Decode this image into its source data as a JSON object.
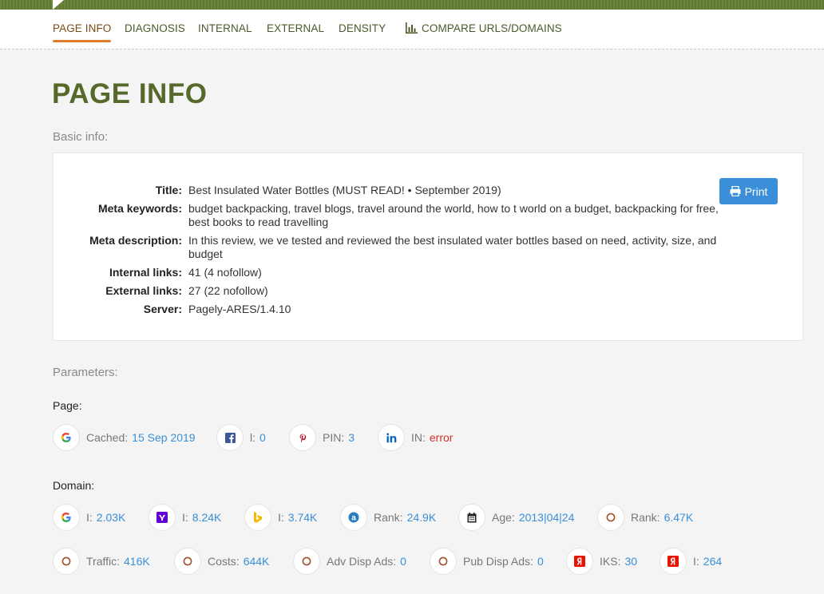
{
  "nav": {
    "items": [
      "PAGE INFO",
      "DIAGNOSIS",
      "INTERNAL",
      "EXTERNAL",
      "DENSITY"
    ],
    "compare_label": "COMPARE URLS/DOMAINS",
    "active": "PAGE INFO"
  },
  "page_title": "PAGE INFO",
  "basic_info": {
    "heading": "Basic info:",
    "rows": [
      {
        "label": "Title:",
        "value": "Best Insulated Water Bottles (MUST READ! • September 2019)"
      },
      {
        "label": "Meta keywords:",
        "value": "budget backpacking, travel blogs, travel around the world, how to t world on a budget, backpacking for free, best books to read travelling"
      },
      {
        "label": "Meta description:",
        "value": "In this review, we ve tested and reviewed the best insulated water bottles based on need, activity, size, and budget"
      },
      {
        "label": "Internal links:",
        "value": "41 (4 nofollow)"
      },
      {
        "label": "External links:",
        "value": "27 (22 nofollow)"
      },
      {
        "label": "Server:",
        "value": "Pagely-ARES/1.4.10"
      }
    ],
    "print_label": "Print"
  },
  "parameters": {
    "heading": "Parameters:",
    "page_label": "Page:",
    "page_metrics": [
      {
        "icon": "google-icon",
        "label": "Cached:",
        "value": "15 Sep 2019"
      },
      {
        "icon": "facebook-icon",
        "label": "l:",
        "value": "0"
      },
      {
        "icon": "pinterest-icon",
        "label": "PIN:",
        "value": "3"
      },
      {
        "icon": "linkedin-icon",
        "label": "IN:",
        "value": "error"
      }
    ],
    "domain_label": "Domain:",
    "domain_metrics_row1": [
      {
        "icon": "google-icon",
        "label": "I:",
        "value": "2.03K"
      },
      {
        "icon": "yahoo-icon",
        "label": "I:",
        "value": "8.24K"
      },
      {
        "icon": "bing-icon",
        "label": "I:",
        "value": "3.74K"
      },
      {
        "icon": "alexa-icon",
        "label": "Rank:",
        "value": "24.9K"
      },
      {
        "icon": "calendar-icon",
        "label": "Age:",
        "value": "2013|04|24"
      },
      {
        "icon": "semrush-icon",
        "label": "Rank:",
        "value": "6.47K"
      }
    ],
    "domain_metrics_row2": [
      {
        "icon": "semrush-icon",
        "label": "Traffic:",
        "value": "416K"
      },
      {
        "icon": "semrush-icon",
        "label": "Costs:",
        "value": "644K"
      },
      {
        "icon": "semrush-icon",
        "label": "Adv Disp Ads:",
        "value": "0"
      },
      {
        "icon": "semrush-icon",
        "label": "Pub Disp Ads:",
        "value": "0"
      },
      {
        "icon": "yandex-icon",
        "label": "IKS:",
        "value": "30"
      },
      {
        "icon": "yandex-icon",
        "label": "I:",
        "value": "264"
      }
    ]
  },
  "colors": {
    "brand_green": "#55692b",
    "accent_orange": "#e07b2a",
    "link_blue": "#3a8fd8",
    "error_red": "#d0302a"
  }
}
